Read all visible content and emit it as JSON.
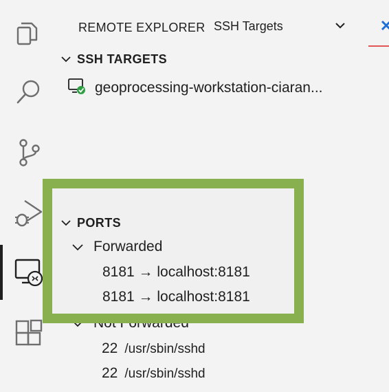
{
  "header": {
    "title": "REMOTE EXPLORER",
    "select_value": "SSH Targets"
  },
  "ssh_targets": {
    "section_label": "SSH TARGETS",
    "hosts": [
      {
        "label": "geoprocessing-workstation-ciaran..."
      }
    ]
  },
  "ports": {
    "section_label": "PORTS",
    "forwarded_label": "Forwarded",
    "forwarded": [
      {
        "label": "8181 → localhost:8181"
      },
      {
        "label": "8181 → localhost:8181"
      }
    ],
    "not_forwarded_label": "Not Forwarded",
    "not_forwarded": [
      {
        "port": "22",
        "process": "/usr/sbin/sshd"
      },
      {
        "port": "22",
        "process": "/usr/sbin/sshd"
      }
    ]
  },
  "activity_bar": {
    "items": [
      "files-icon",
      "search-icon",
      "source-control-icon",
      "run-debug-icon",
      "remote-explorer-icon",
      "extensions-icon"
    ],
    "active": "remote-explorer-icon"
  },
  "colors": {
    "highlight": "#88b04f",
    "success": "#2ea043",
    "accent_underline": "#e25555"
  }
}
